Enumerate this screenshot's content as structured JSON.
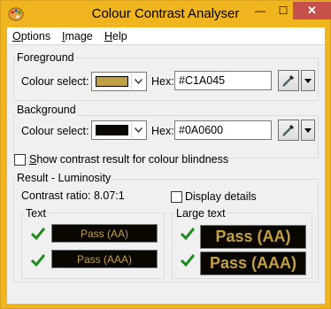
{
  "window": {
    "title": "Colour Contrast Analyser",
    "minimize": "—",
    "maximize": "☐",
    "close": "✕"
  },
  "menu": [
    {
      "label_u": "O",
      "label_rest": "ptions"
    },
    {
      "label_u": "I",
      "label_rest": "mage"
    },
    {
      "label_u": "H",
      "label_rest": "elp"
    }
  ],
  "foreground": {
    "group_label": "Foreground",
    "colour_select_label": "Colour select:",
    "hex_label": "Hex:",
    "hex_value": "#C1A045",
    "swatch_color": "#C1A045"
  },
  "background": {
    "group_label": "Background",
    "colour_select_label": "Colour select:",
    "hex_label": "Hex:",
    "hex_value": "#0A0600",
    "swatch_color": "#0A0600"
  },
  "blindness": {
    "label_u": "S",
    "label_rest": "how contrast result for colour blindness"
  },
  "result": {
    "group_label": "Result - Luminosity",
    "contrast_ratio": "Contrast ratio: 8.07:1",
    "display_details": "Display details",
    "text_group": "Text",
    "large_group": "Large text",
    "text_aa": "Pass (AA)",
    "text_aaa": "Pass (AAA)",
    "large_aa": "Pass (AA)",
    "large_aaa": "Pass (AAA)"
  },
  "colors": {
    "pass_fg": "#C1A045",
    "pass_bg": "#0A0600",
    "check_green": "#1e8c1e",
    "title_bar": "#F0B51E",
    "close_red": "#C7504A"
  }
}
